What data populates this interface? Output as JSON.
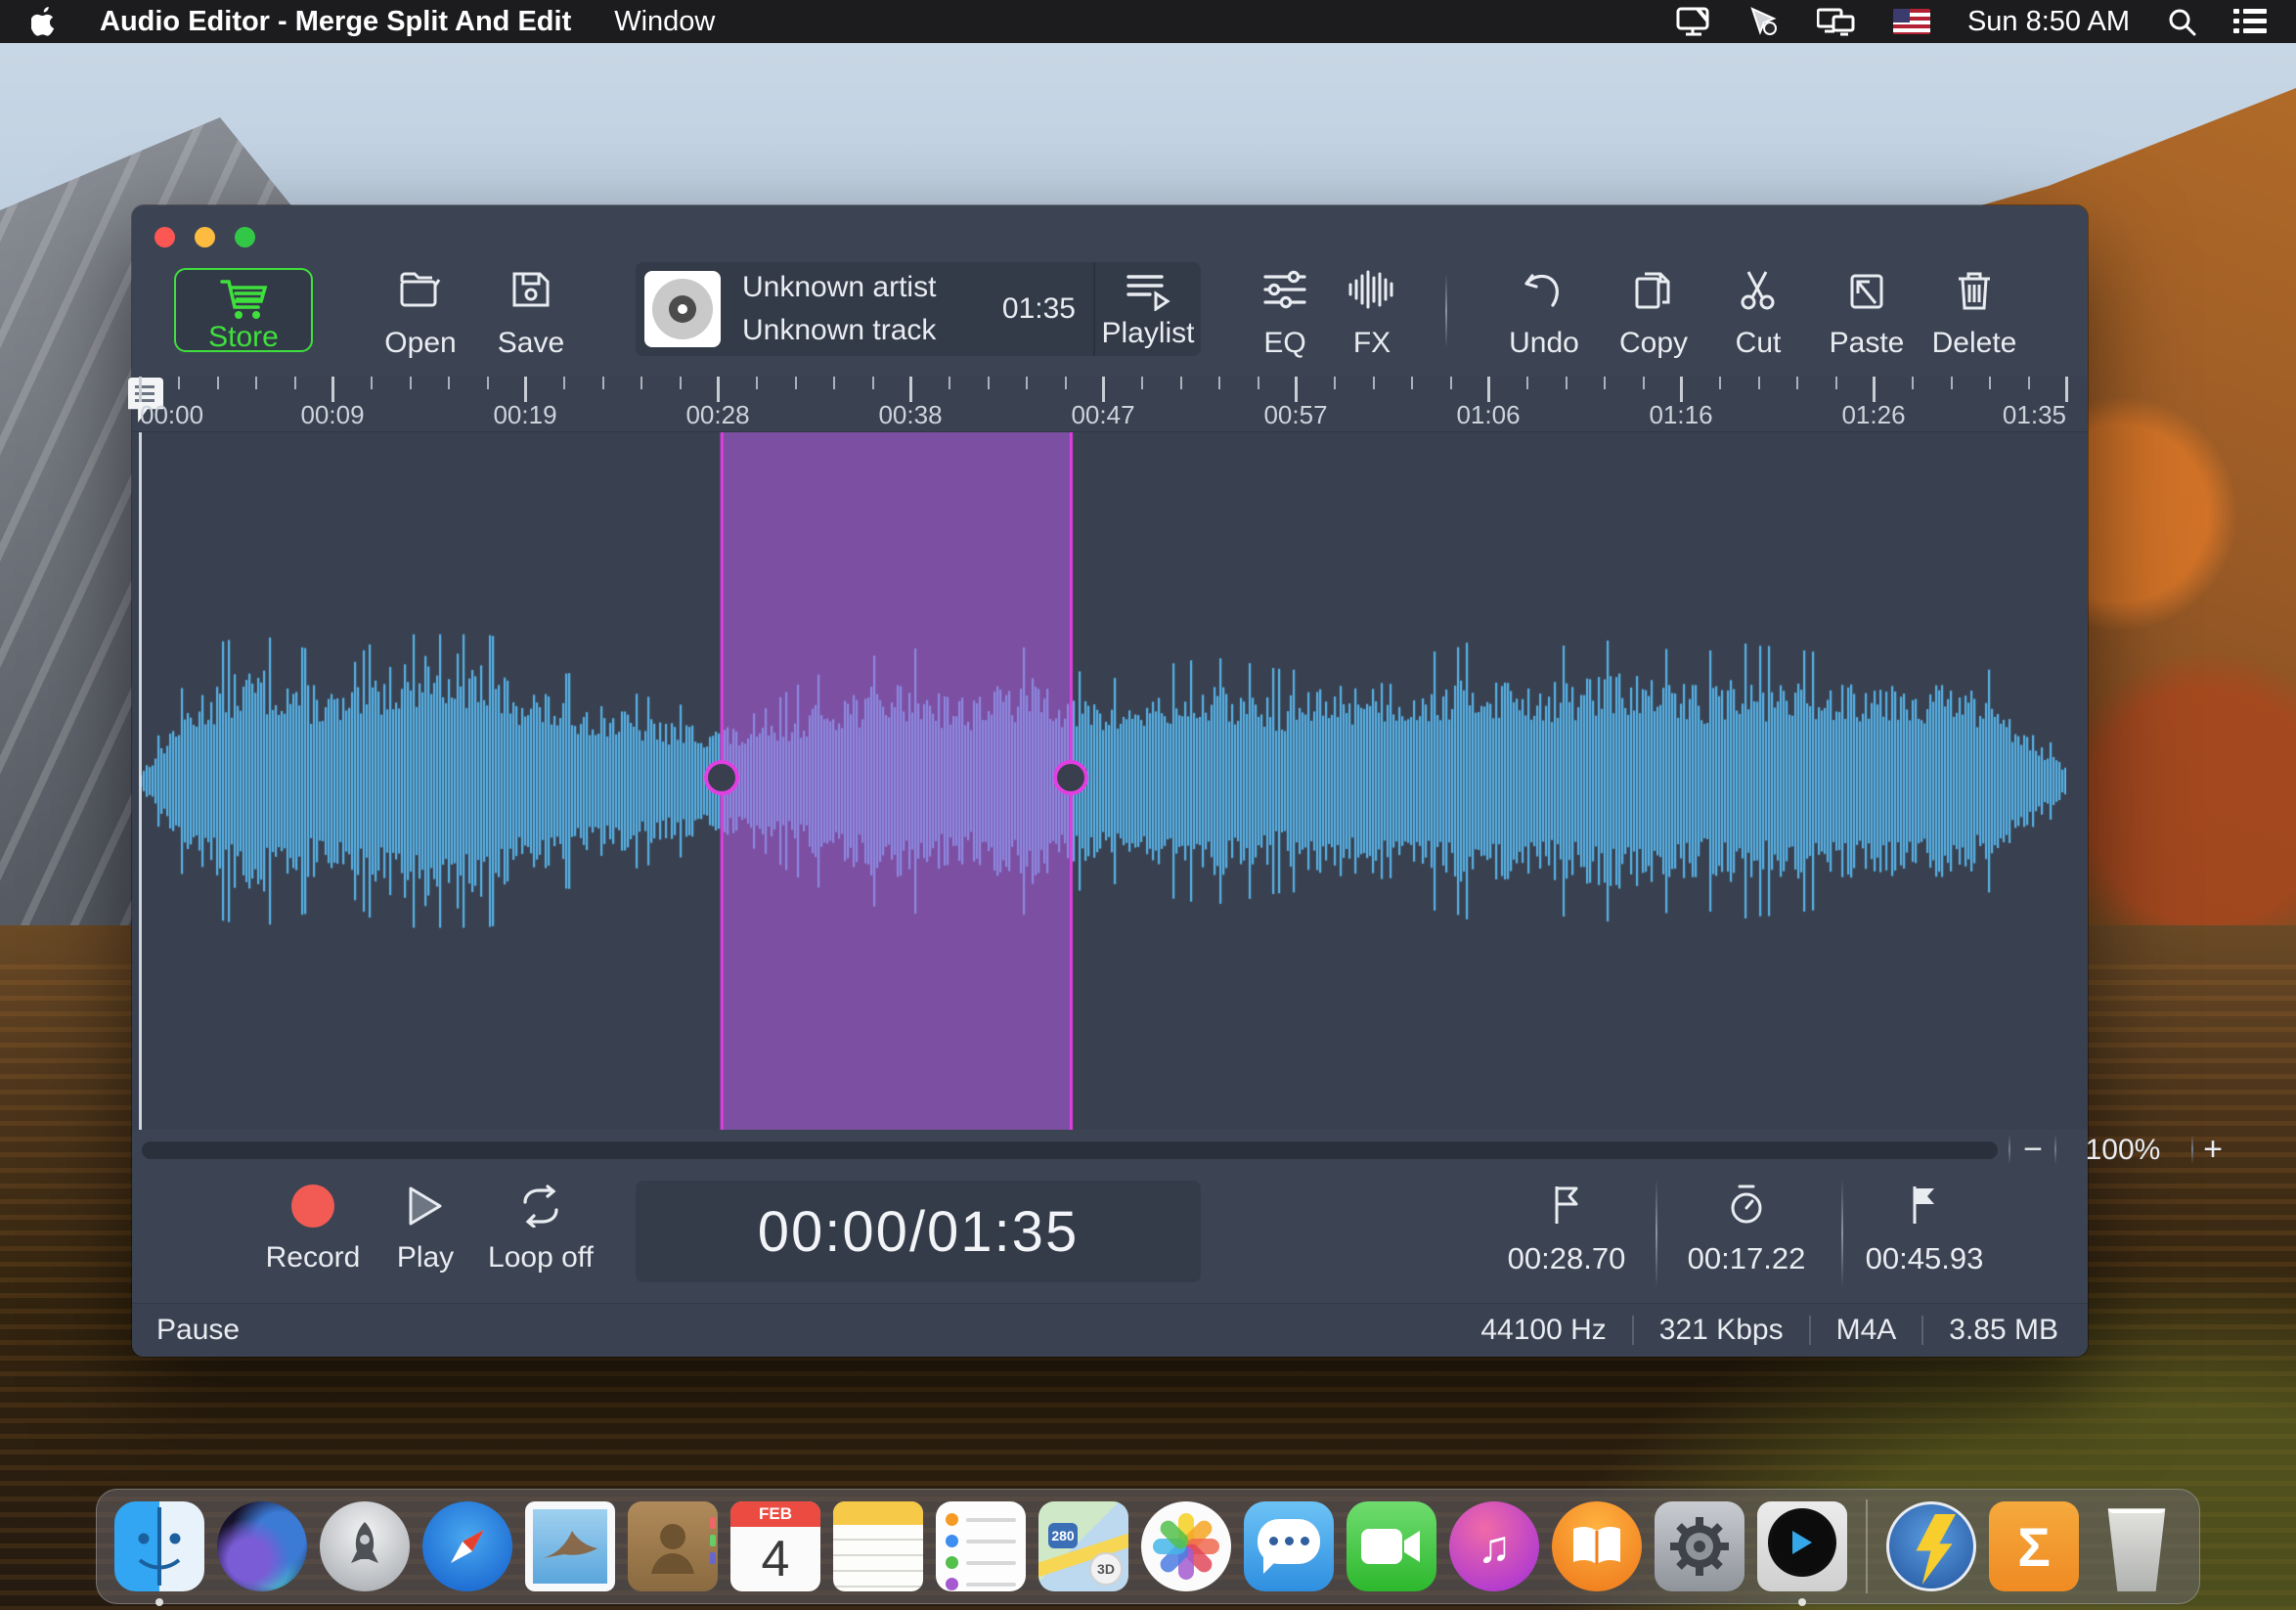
{
  "menu_bar": {
    "app_name": "Audio Editor - Merge Split And Edit",
    "menus": [
      "Window"
    ],
    "clock": "Sun 8:50 AM"
  },
  "toolbar": {
    "store": "Store",
    "open": "Open",
    "save": "Save",
    "track": {
      "artist": "Unknown artist",
      "title": "Unknown track",
      "duration": "01:35"
    },
    "playlist": "Playlist",
    "eq": "EQ",
    "fx": "FX",
    "undo": "Undo",
    "copy": "Copy",
    "cut": "Cut",
    "paste": "Paste",
    "delete": "Delete"
  },
  "timeline": {
    "ticks": [
      "00:00",
      "00:09",
      "00:19",
      "00:28",
      "00:38",
      "00:47",
      "00:57",
      "01:06",
      "01:16",
      "01:26",
      "01:35"
    ]
  },
  "zoom": {
    "minus": "−",
    "level": "100%",
    "plus": "+"
  },
  "transport": {
    "record": "Record",
    "play": "Play",
    "loop": "Loop off",
    "position": "00:00/01:35"
  },
  "selection": {
    "start": "00:28.70",
    "length": "00:17.22",
    "end": "00:45.93"
  },
  "status": {
    "state": "Pause",
    "sample_rate": "44100 Hz",
    "bitrate": "321 Kbps",
    "format": "M4A",
    "size": "3.85 MB"
  },
  "dock": {
    "calendar_month": "FEB",
    "calendar_day": "4",
    "maps_road_number": "280",
    "maps_3d": "3D",
    "sigma": "Σ",
    "itunes_note": "♫"
  },
  "colors": {
    "wave": "#58b2e6",
    "wave_selected": "#8c89e0",
    "selection_fill": "#7c4fa2",
    "selection_border": "#e23fe2",
    "wave_bg": "#394150",
    "accent_green": "#3fe03c",
    "record_red": "#f25b54"
  },
  "waveform": {
    "total_seconds": 95,
    "selection_start_s": 28.7,
    "selection_end_s": 45.93,
    "envelope": [
      0.06,
      0.5,
      0.75,
      0.8,
      0.72,
      0.6,
      0.82,
      0.95,
      0.88,
      0.72,
      0.6,
      0.55,
      0.48,
      0.42,
      0.4,
      0.36,
      0.52,
      0.62,
      0.68,
      0.72,
      0.6,
      0.68,
      0.74,
      0.58,
      0.56,
      0.62,
      0.68,
      0.64,
      0.6,
      0.66,
      0.72,
      0.68,
      0.73,
      0.75,
      0.7,
      0.73,
      0.77,
      0.72,
      0.7,
      0.75,
      0.73,
      0.7,
      0.74,
      0.72,
      0.68,
      0.62,
      0.4,
      0.08
    ]
  }
}
